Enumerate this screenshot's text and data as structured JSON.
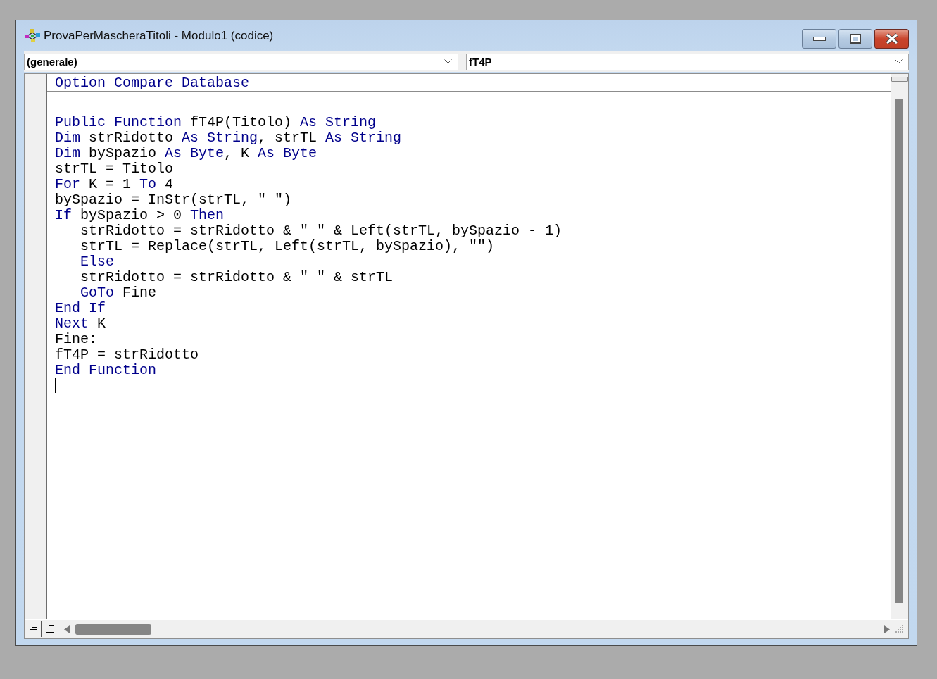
{
  "window": {
    "title": "ProvaPerMascheraTitoli - Modulo1 (codice)"
  },
  "object_box": {
    "value": "(generale)"
  },
  "procedure_box": {
    "value": "fT4P"
  },
  "declarations": [
    [
      {
        "text": "Option Compare Database",
        "kind": "keyword"
      }
    ]
  ],
  "code_lines": [
    [
      {
        "text": "Public Function",
        "kind": "keyword"
      },
      {
        "text": " fT4P(Titolo) ",
        "kind": "plain"
      },
      {
        "text": "As String",
        "kind": "keyword"
      }
    ],
    [
      {
        "text": "Dim",
        "kind": "keyword"
      },
      {
        "text": " strRidotto ",
        "kind": "plain"
      },
      {
        "text": "As String",
        "kind": "keyword"
      },
      {
        "text": ", strTL ",
        "kind": "plain"
      },
      {
        "text": "As String",
        "kind": "keyword"
      }
    ],
    [
      {
        "text": "Dim",
        "kind": "keyword"
      },
      {
        "text": " bySpazio ",
        "kind": "plain"
      },
      {
        "text": "As Byte",
        "kind": "keyword"
      },
      {
        "text": ", K ",
        "kind": "plain"
      },
      {
        "text": "As Byte",
        "kind": "keyword"
      }
    ],
    [
      {
        "text": "strTL = Titolo",
        "kind": "plain"
      }
    ],
    [
      {
        "text": "For",
        "kind": "keyword"
      },
      {
        "text": " K = 1 ",
        "kind": "plain"
      },
      {
        "text": "To",
        "kind": "keyword"
      },
      {
        "text": " 4",
        "kind": "plain"
      }
    ],
    [
      {
        "text": "bySpazio = InStr(strTL, \" \")",
        "kind": "plain"
      }
    ],
    [
      {
        "text": "If",
        "kind": "keyword"
      },
      {
        "text": " bySpazio > 0 ",
        "kind": "plain"
      },
      {
        "text": "Then",
        "kind": "keyword"
      }
    ],
    [
      {
        "text": "   strRidotto = strRidotto & \" \" & Left(strTL, bySpazio - 1)",
        "kind": "plain"
      }
    ],
    [
      {
        "text": "   strTL = Replace(strTL, Left(strTL, bySpazio), \"\")",
        "kind": "plain"
      }
    ],
    [
      {
        "text": "   Else",
        "kind": "keyword"
      }
    ],
    [
      {
        "text": "   strRidotto = strRidotto & \" \" & strTL",
        "kind": "plain"
      }
    ],
    [
      {
        "text": "   GoTo",
        "kind": "keyword"
      },
      {
        "text": " Fine",
        "kind": "plain"
      }
    ],
    [
      {
        "text": "End If",
        "kind": "keyword"
      }
    ],
    [
      {
        "text": "Next",
        "kind": "keyword"
      },
      {
        "text": " K",
        "kind": "plain"
      }
    ],
    [
      {
        "text": "Fine:",
        "kind": "plain"
      }
    ],
    [
      {
        "text": "fT4P = strRidotto",
        "kind": "plain"
      }
    ],
    [
      {
        "text": "End Function",
        "kind": "keyword"
      }
    ]
  ],
  "view_buttons": [
    {
      "kind": "procedure",
      "selected": false
    },
    {
      "kind": "module",
      "selected": true
    }
  ]
}
